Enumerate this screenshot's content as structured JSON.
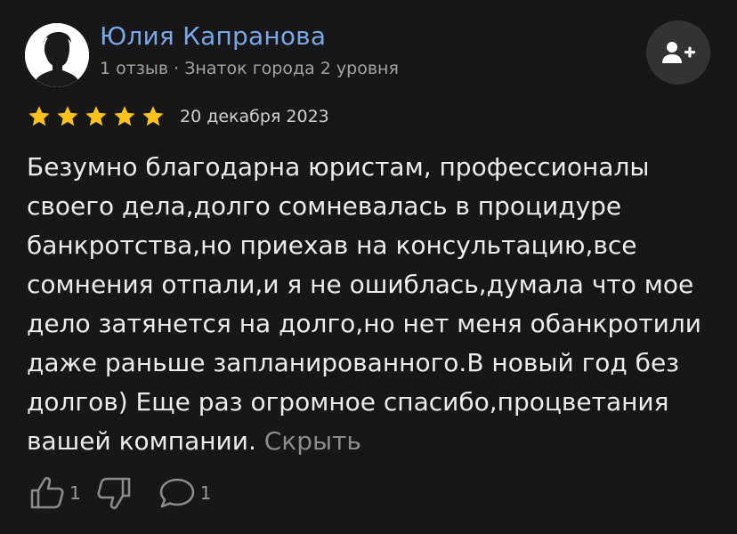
{
  "author": {
    "name": "Юлия Капранова",
    "meta": "1 отзыв · Знаток города 2 уровня"
  },
  "rating": {
    "stars": 5,
    "max": 5,
    "color": "#fcc419"
  },
  "review": {
    "date": "20 декабря 2023",
    "text": "Безумно благодарна юристам, профессионалы своего дела,долго сомневалась в процидуре банкротства,но приехав на консультацию,все сомнения отпали,и я не ошиблась,думала что мое дело затянется на долго,но нет меня обанкротили даже раньше запланированного.В новый год без долгов) Еще раз огромное спасибо,процветания вашей компании.",
    "hide_label": "Скрыть"
  },
  "reactions": {
    "likes": "1",
    "comments": "1"
  },
  "icons": {
    "avatar": "user-silhouette-icon",
    "subscribe": "add-user-icon",
    "like": "thumbs-up-icon",
    "dislike": "thumbs-down-icon",
    "comment": "comment-bubble-icon"
  },
  "colors": {
    "background": "#171717",
    "author_name": "#79a7e8",
    "star": "#fcc419"
  }
}
